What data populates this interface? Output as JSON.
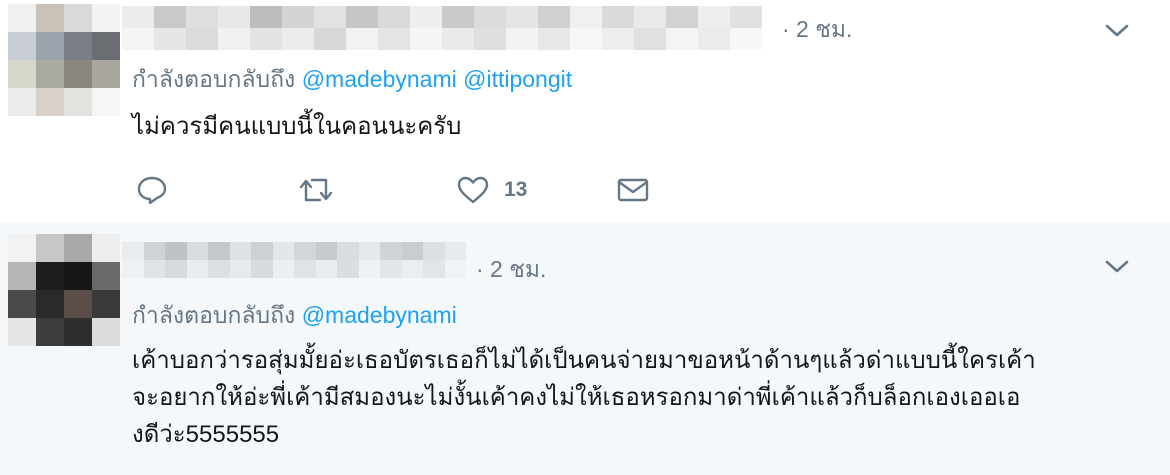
{
  "tweets": [
    {
      "timestamp": "· 2 ชม.",
      "replying_prefix": "กำลังตอบกลับถึง",
      "mentions": [
        "@madebynami",
        "@ittipongit"
      ],
      "text_lines": [
        "ไม่ควรมีคนแบบนี้ในคอนนะครับ"
      ],
      "like_count": "13",
      "icons": [
        "reply-icon",
        "retweet-icon",
        "like-icon",
        "message-icon",
        "chevron-down-icon"
      ]
    },
    {
      "timestamp": "· 2 ชม.",
      "replying_prefix": "กำลังตอบกลับถึง",
      "mentions": [
        "@madebynami"
      ],
      "text_lines": [
        "เค้าบอกว่ารอสุ่มมั้ยอ่ะเธอบัตรเธอก็ไม่ได้เป็นคนจ่ายมาขอหน้าด้านๆแล้วด่าแบบนี้ใครเค้า",
        "จะอยากให้อ่ะพี่เค้ามีสมองนะไม่งั้นเค้าคงไม่ให้เธอหรอกมาด่าพี่เค้าแล้วก็บล็อกเองเออเอ",
        "งดีว่ะ5555555"
      ],
      "icons": [
        "chevron-down-icon"
      ]
    }
  ],
  "colors": {
    "link": "#1da1f2",
    "secondary_text": "#657786",
    "primary_text": "#14171a",
    "highlight_background": "#f5f8fa"
  }
}
